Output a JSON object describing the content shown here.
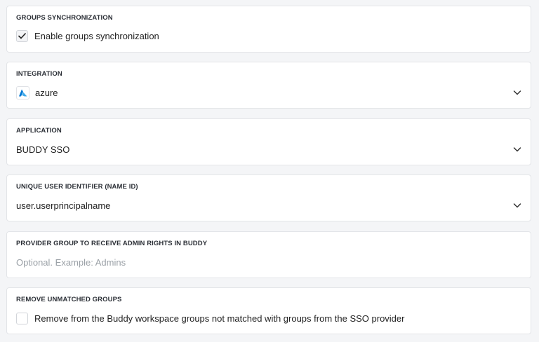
{
  "groups_sync": {
    "label": "GROUPS SYNCHRONIZATION",
    "checkbox_label": "Enable groups synchronization",
    "checked": true
  },
  "integration": {
    "label": "INTEGRATION",
    "value": "azure",
    "icon": "azure-logo-icon"
  },
  "application": {
    "label": "APPLICATION",
    "value": "BUDDY SSO"
  },
  "unique_id": {
    "label": "UNIQUE USER IDENTIFIER (NAME ID)",
    "value": "user.userprincipalname"
  },
  "admin_group": {
    "label": "PROVIDER GROUP TO RECEIVE ADMIN RIGHTS IN BUDDY",
    "placeholder": "Optional. Example: Admins",
    "value": ""
  },
  "remove_unmatched": {
    "label": "REMOVE UNMATCHED GROUPS",
    "checkbox_label": "Remove from the Buddy workspace groups not matched with groups from the SSO provider",
    "checked": false
  },
  "colors": {
    "azure_blue": "#0078d4",
    "azure_light": "#3ea8e8"
  }
}
